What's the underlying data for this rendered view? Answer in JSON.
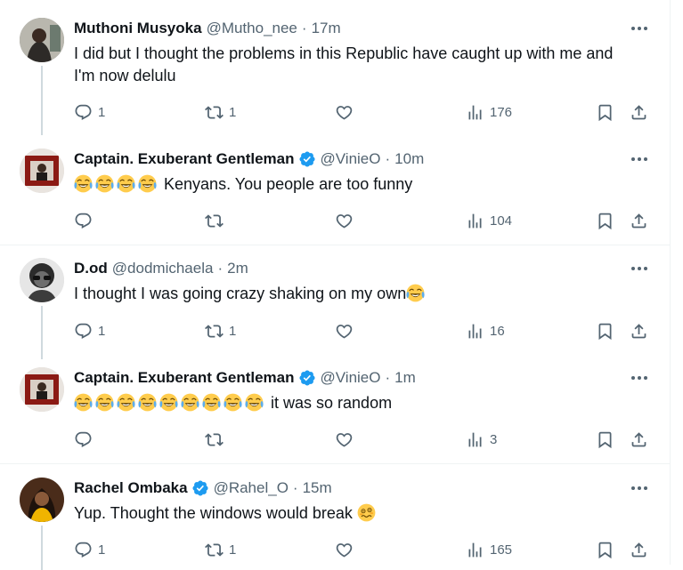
{
  "colors": {
    "verified": "#1d9bf0",
    "muted": "#536471",
    "text": "#0f1419",
    "thread_line": "#cfd9de",
    "divider": "#eff3f4"
  },
  "tweets": [
    {
      "name": "Muthoni Musyoka",
      "handle": "@Mutho_nee",
      "separator": "·",
      "time": "17m",
      "verified": false,
      "text": "I did but I thought the problems in this Republic have caught up with me and I'm now delulu",
      "emoji": [],
      "replies": "1",
      "retweets": "1",
      "likes": "",
      "views": "176"
    },
    {
      "name": "Captain. Exuberant Gentleman",
      "handle": "@VinieO",
      "separator": "·",
      "time": "10m",
      "verified": true,
      "text": "Kenyans. You people are too funny",
      "emoji": [
        "face-with-tears-of-joy",
        "face-with-tears-of-joy",
        "face-with-tears-of-joy",
        "face-with-tears-of-joy"
      ],
      "replies": "",
      "retweets": "",
      "likes": "",
      "views": "104"
    },
    {
      "name": "D.od",
      "handle": "@dodmichaela",
      "separator": "·",
      "time": "2m",
      "verified": false,
      "text": "I thought I was going crazy shaking on my own",
      "emoji": [
        "face-with-tears-of-joy"
      ],
      "replies": "1",
      "retweets": "1",
      "likes": "",
      "views": "16"
    },
    {
      "name": "Captain. Exuberant Gentleman",
      "handle": "@VinieO",
      "separator": "·",
      "time": "1m",
      "verified": true,
      "text": "it was so random",
      "emoji": [
        "face-with-tears-of-joy",
        "face-with-tears-of-joy",
        "face-with-tears-of-joy",
        "face-with-tears-of-joy",
        "face-with-tears-of-joy",
        "face-with-tears-of-joy",
        "face-with-tears-of-joy",
        "face-with-tears-of-joy",
        "face-with-tears-of-joy"
      ],
      "replies": "",
      "retweets": "",
      "likes": "",
      "views": "3"
    },
    {
      "name": "Rachel Ombaka",
      "handle": "@Rahel_O",
      "separator": "·",
      "time": "15m",
      "verified": true,
      "text": "Yup. Thought the windows would break",
      "emoji": [
        "woozy-face"
      ],
      "replies": "1",
      "retweets": "1",
      "likes": "",
      "views": "165"
    }
  ]
}
